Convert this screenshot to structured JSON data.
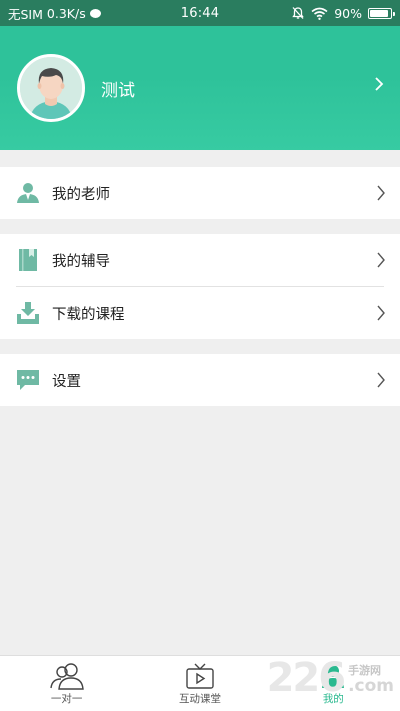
{
  "status": {
    "carrier": "无SIM",
    "speed": "0.3K/s",
    "time": "16:44",
    "battery": "90%",
    "battery_level": 0.9
  },
  "profile": {
    "name": "测试"
  },
  "menu": {
    "teacher": "我的老师",
    "tutoring": "我的辅导",
    "downloads": "下载的课程",
    "settings": "设置"
  },
  "tabs": [
    {
      "label": "一对一",
      "icon": "users-icon"
    },
    {
      "label": "互动课堂",
      "icon": "tv-play-icon"
    },
    {
      "label": "我的",
      "icon": "person-icon"
    }
  ],
  "watermark": {
    "digits": "226",
    "line1": "手游网",
    "line2": ".com"
  },
  "colors": {
    "accent": "#2ec29a",
    "statusbar": "#2a7d5f",
    "icon": "#6fb9a4"
  }
}
